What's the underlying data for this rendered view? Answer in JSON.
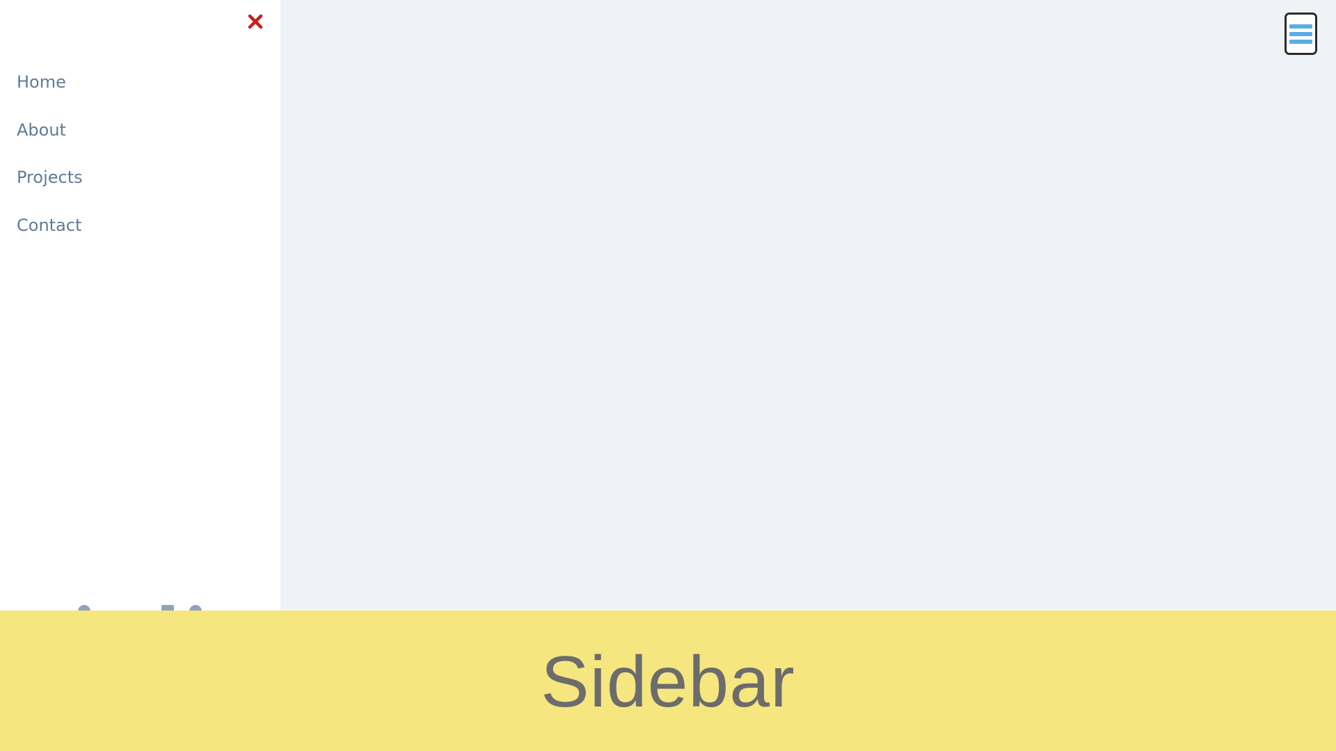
{
  "sidebar": {
    "close_icon": "close-icon",
    "close_color": "#c81e1e",
    "items": [
      {
        "label": "Home"
      },
      {
        "label": "About"
      },
      {
        "label": "Projects"
      },
      {
        "label": "Contact"
      }
    ]
  },
  "main": {
    "menu_icon": "hamburger-menu-icon",
    "menu_bar_color": "#5aaee6",
    "background": "#eff3f7"
  },
  "banner": {
    "title": "Sidebar",
    "background": "#f6e67f"
  }
}
